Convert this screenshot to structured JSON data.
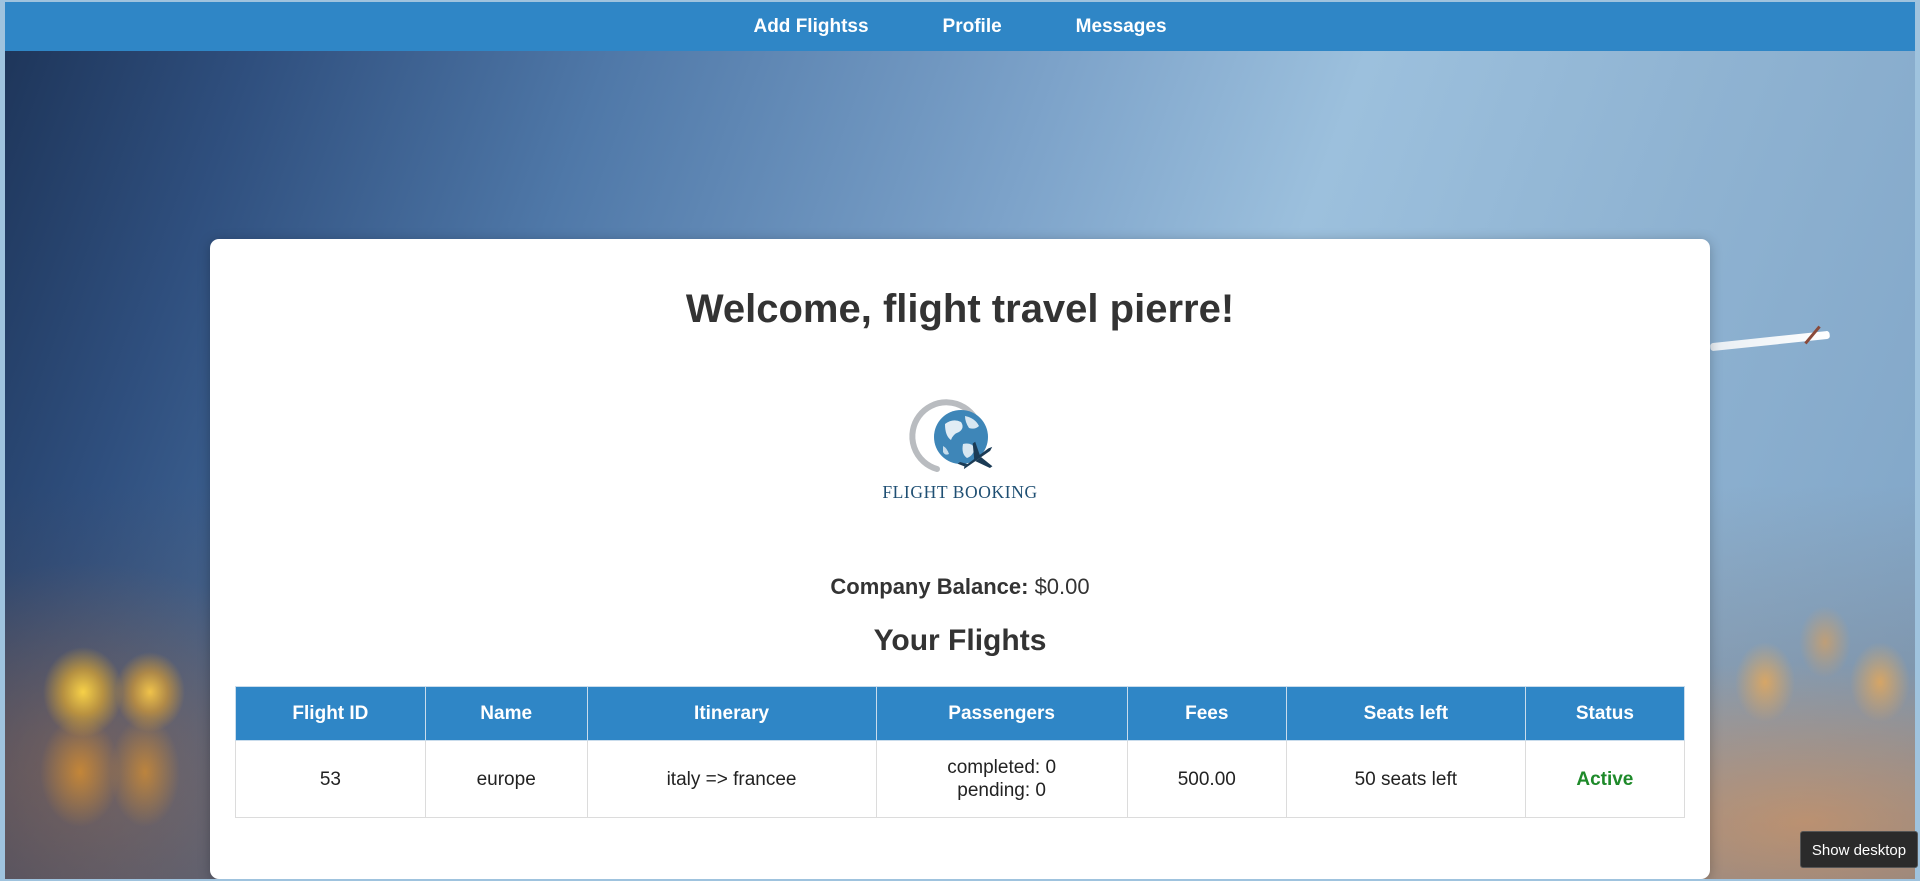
{
  "nav": {
    "items": [
      {
        "label": "Add Flightss"
      },
      {
        "label": "Profile"
      },
      {
        "label": "Messages"
      }
    ]
  },
  "main": {
    "welcome": "Welcome, flight travel pierre!",
    "logo_text": "FLIGHT BOOKING",
    "balance_label": "Company Balance:",
    "balance_value": "$0.00",
    "flights_heading": "Your Flights"
  },
  "table": {
    "headers": [
      "Flight ID",
      "Name",
      "Itinerary",
      "Passengers",
      "Fees",
      "Seats left",
      "Status"
    ],
    "rows": [
      {
        "flight_id": "53",
        "name": "europe",
        "itinerary": "italy => francee",
        "passengers_completed": "completed: 0",
        "passengers_pending": "pending: 0",
        "fees": "500.00",
        "seats_left": "50 seats left",
        "status": "Active"
      }
    ]
  },
  "colors": {
    "navbar": "#2f86c6",
    "table_header": "#2f86c6",
    "status_active": "#1e8a2a"
  },
  "tooltip": {
    "show_desktop": "Show desktop"
  }
}
